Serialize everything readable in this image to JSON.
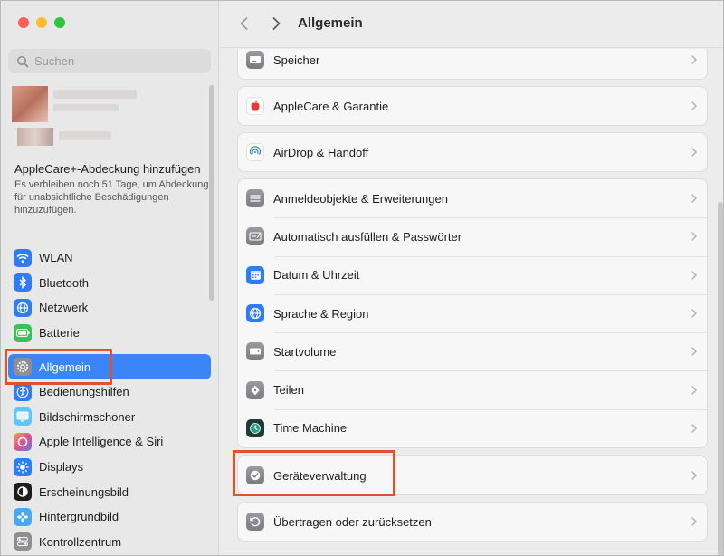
{
  "window": {
    "title": "Allgemein"
  },
  "sidebar": {
    "search_placeholder": "Suchen",
    "applecare": {
      "title": "AppleCare+-Abdeckung hinzufügen",
      "subtitle": "Es verbleiben noch 51 Tage, um Abdeckung für unabsichtliche Beschädigungen hinzuzufügen."
    },
    "items": [
      {
        "label": "WLAN",
        "icon": "wifi-icon",
        "color": "#2f7cf6"
      },
      {
        "label": "Bluetooth",
        "icon": "bluetooth-icon",
        "color": "#2f7cf6"
      },
      {
        "label": "Netzwerk",
        "icon": "globe-icon",
        "color": "#2f7cf6"
      },
      {
        "label": "Batterie",
        "icon": "battery-icon",
        "color": "#38c157"
      },
      {
        "label": "Allgemein",
        "icon": "gear-icon",
        "color": "#8e8e93",
        "selected": true
      },
      {
        "label": "Bedienungshilfen",
        "icon": "accessibility-icon",
        "color": "#2f7cf6"
      },
      {
        "label": "Bildschirmschoner",
        "icon": "screensaver-icon",
        "color": "#5ac8fa"
      },
      {
        "label": "Apple Intelligence & Siri",
        "icon": "siri-icon",
        "color": "#d9579b"
      },
      {
        "label": "Displays",
        "icon": "sun-icon",
        "color": "#2f7cf6"
      },
      {
        "label": "Erscheinungsbild",
        "icon": "appearance-icon",
        "color": "#1d1d1f"
      },
      {
        "label": "Hintergrundbild",
        "icon": "flower-icon",
        "color": "#4aa8f0"
      },
      {
        "label": "Kontrollzentrum",
        "icon": "control-center-icon",
        "color": "#8e8e93"
      }
    ]
  },
  "main": {
    "title": "Allgemein",
    "groups": [
      {
        "rows": [
          {
            "label": "Speicher",
            "icon": "storage-icon"
          }
        ]
      },
      {
        "rows": [
          {
            "label": "AppleCare & Garantie",
            "icon": "apple-icon"
          }
        ]
      },
      {
        "rows": [
          {
            "label": "AirDrop & Handoff",
            "icon": "airdrop-icon"
          }
        ]
      },
      {
        "rows": [
          {
            "label": "Anmeldeobjekte & Erweiterungen",
            "icon": "login-items-icon"
          },
          {
            "label": "Automatisch ausfüllen & Passwörter",
            "icon": "autofill-icon"
          },
          {
            "label": "Datum & Uhrzeit",
            "icon": "calendar-icon"
          },
          {
            "label": "Sprache & Region",
            "icon": "globe-icon"
          },
          {
            "label": "Startvolume",
            "icon": "disk-icon"
          },
          {
            "label": "Teilen",
            "icon": "share-icon"
          },
          {
            "label": "Time Machine",
            "icon": "time-machine-icon"
          }
        ]
      },
      {
        "rows": [
          {
            "label": "Geräteverwaltung",
            "icon": "device-management-icon"
          }
        ]
      },
      {
        "rows": [
          {
            "label": "Übertragen oder zurücksetzen",
            "icon": "reset-icon"
          }
        ]
      }
    ]
  },
  "colors": {
    "accent": "#3b86f7",
    "highlight": "#e0522f"
  }
}
